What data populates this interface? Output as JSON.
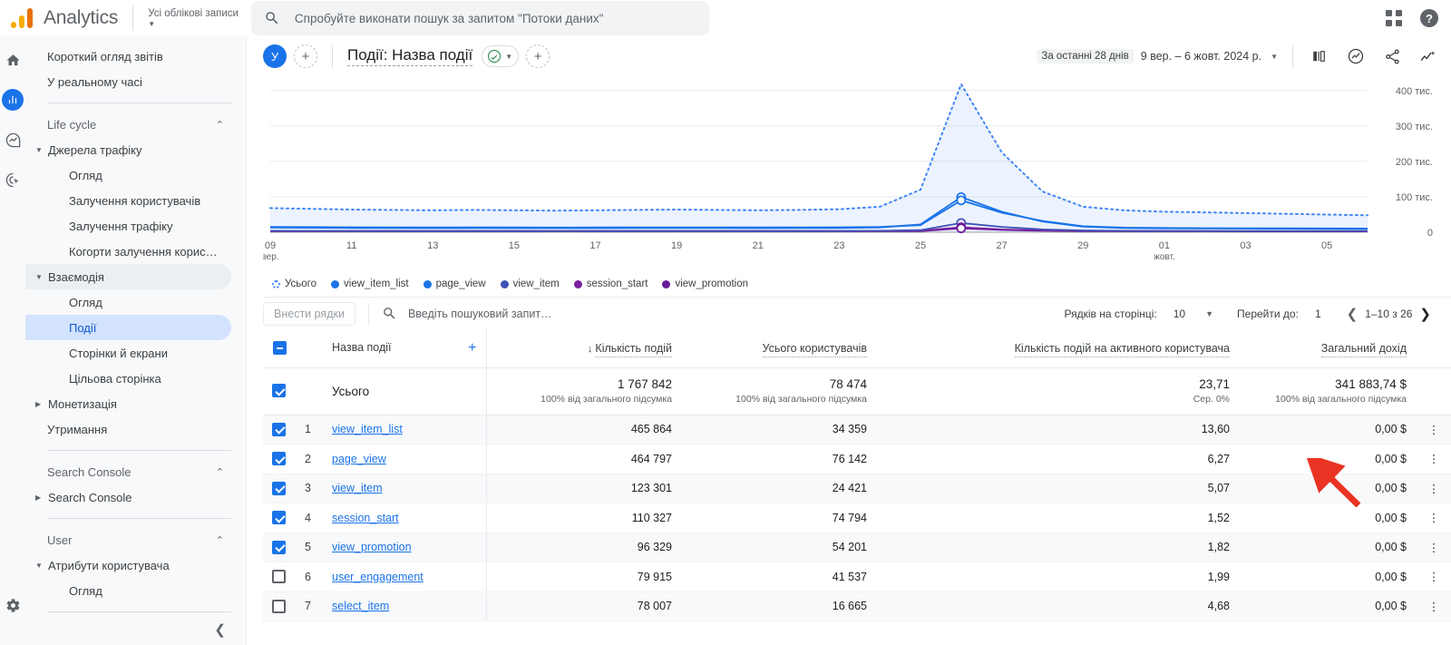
{
  "topbar": {
    "brand": "Analytics",
    "account_selector": "Усі облікові записи",
    "search_placeholder": "Спробуйте виконати пошук за запитом \"Потоки даних\"",
    "search_value": "",
    "apps_icon": "grid-apps-icon",
    "help_icon": "help-icon"
  },
  "rail": {
    "items": [
      {
        "name": "home-icon",
        "label": "Home"
      },
      {
        "name": "reports-icon",
        "label": "Reports"
      },
      {
        "name": "explore-icon",
        "label": "Explore"
      },
      {
        "name": "advertising-icon",
        "label": "Advertising"
      }
    ],
    "settings_icon": "gear-icon"
  },
  "sidebar": {
    "items": [
      {
        "label": "Короткий огляд звітів",
        "level": 1,
        "type": "link"
      },
      {
        "label": "У реальному часі",
        "level": 1,
        "type": "link"
      },
      {
        "type": "separator"
      },
      {
        "label": "Life cycle",
        "level": 1,
        "type": "section",
        "state": "expanded"
      },
      {
        "label": "Джерела трафіку",
        "level": 1,
        "type": "group",
        "state": "expanded"
      },
      {
        "label": "Огляд",
        "level": 2,
        "type": "link"
      },
      {
        "label": "Залучення користувачів",
        "level": 2,
        "type": "link"
      },
      {
        "label": "Залучення трафіку",
        "level": 2,
        "type": "link"
      },
      {
        "label": "Когорти залучення корис…",
        "level": 2,
        "type": "link"
      },
      {
        "label": "Взаємодія",
        "level": 1,
        "type": "group",
        "state": "expanded",
        "highlight": true
      },
      {
        "label": "Огляд",
        "level": 2,
        "type": "link"
      },
      {
        "label": "Події",
        "level": 2,
        "type": "link",
        "selected": true
      },
      {
        "label": "Сторінки й екрани",
        "level": 2,
        "type": "link"
      },
      {
        "label": "Цільова сторінка",
        "level": 2,
        "type": "link"
      },
      {
        "label": "Монетизація",
        "level": 1,
        "type": "group",
        "state": "collapsed"
      },
      {
        "label": "Утримання",
        "level": 1,
        "type": "link"
      },
      {
        "type": "separator"
      },
      {
        "label": "Search Console",
        "level": 1,
        "type": "section",
        "state": "expanded"
      },
      {
        "label": "Search Console",
        "level": 1,
        "type": "group",
        "state": "collapsed"
      },
      {
        "type": "separator"
      },
      {
        "label": "User",
        "level": 1,
        "type": "section",
        "state": "expanded"
      },
      {
        "label": "Атрибути користувача",
        "level": 1,
        "type": "group",
        "state": "expanded"
      },
      {
        "label": "Огляд",
        "level": 2,
        "type": "link"
      },
      {
        "type": "separator"
      }
    ],
    "collapse_icon": "chevron-left-icon"
  },
  "report_header": {
    "avatar_initial": "У",
    "add_comparison": "+",
    "title": "Події: Назва події",
    "validation_icon": "check-circle-icon",
    "add_filter": "+",
    "date_badge": "За останні 28 днів",
    "date_range": "9 вер. – 6 жовт. 2024 р.",
    "icons": [
      {
        "name": "compare-icon"
      },
      {
        "name": "insights-icon"
      },
      {
        "name": "share-icon"
      },
      {
        "name": "trend-icon"
      }
    ]
  },
  "chart_data": {
    "type": "line",
    "title": "",
    "xlabel": "",
    "ylabel": "",
    "ylim": [
      0,
      420000
    ],
    "yticks": [
      0,
      100000,
      200000,
      300000,
      400000
    ],
    "ytick_labels": [
      "0",
      "100 тис.",
      "200 тис.",
      "300 тис.",
      "400 тис."
    ],
    "grid": true,
    "legend_position": "bottom",
    "x": [
      "09",
      "10",
      "11",
      "12",
      "13",
      "14",
      "15",
      "16",
      "17",
      "18",
      "19",
      "20",
      "21",
      "22",
      "23",
      "24",
      "25",
      "26",
      "27",
      "28",
      "29",
      "30",
      "01",
      "02",
      "03",
      "04",
      "05",
      "06"
    ],
    "xtick_labels": [
      "09\nвер.",
      "11",
      "13",
      "15",
      "17",
      "19",
      "21",
      "23",
      "25",
      "27",
      "29",
      "01\nжовт.",
      "03",
      "05"
    ],
    "x_axis_month_start": "вер.",
    "x_axis_month_second": "жовт.",
    "series": [
      {
        "name": "Усього",
        "color": "#4285f4",
        "style": "dotted",
        "filled": true,
        "values": [
          68000,
          66000,
          64000,
          63000,
          62000,
          63000,
          62000,
          61000,
          62000,
          63000,
          64000,
          63000,
          62000,
          63000,
          65000,
          72000,
          120000,
          418000,
          225000,
          115000,
          72000,
          62000,
          58000,
          56000,
          54000,
          52000,
          50000,
          48000
        ]
      },
      {
        "name": "view_item_list",
        "color": "#1a73e8",
        "style": "solid",
        "values": [
          13000,
          12500,
          12000,
          11800,
          11500,
          11700,
          11600,
          11400,
          11500,
          11700,
          11900,
          11800,
          11600,
          11700,
          12000,
          13500,
          22000,
          99000,
          58000,
          30000,
          16000,
          12000,
          11000,
          10500,
          10200,
          10000,
          9800,
          9600
        ]
      },
      {
        "name": "page_view",
        "color": "#1a73e8",
        "style": "solid",
        "values": [
          15000,
          14500,
          14000,
          13800,
          13500,
          13700,
          13600,
          13400,
          13500,
          13700,
          13900,
          13800,
          13600,
          13700,
          14000,
          15000,
          20000,
          90000,
          55000,
          32000,
          17000,
          13000,
          12000,
          11500,
          11200,
          11000,
          10800,
          10600
        ]
      },
      {
        "name": "view_item",
        "color": "#3f51b5",
        "style": "solid",
        "values": [
          4000,
          3900,
          3800,
          3750,
          3700,
          3750,
          3720,
          3700,
          3720,
          3750,
          3800,
          3780,
          3750,
          3780,
          3850,
          4100,
          6000,
          26000,
          15000,
          8000,
          5000,
          4000,
          3800,
          3700,
          3650,
          3600,
          3550,
          3500
        ]
      },
      {
        "name": "session_start",
        "color": "#7b1fa2",
        "style": "solid",
        "values": [
          3400,
          3350,
          3300,
          3280,
          3250,
          3280,
          3260,
          3240,
          3260,
          3280,
          3300,
          3290,
          3270,
          3290,
          3320,
          3400,
          4000,
          14000,
          8000,
          5000,
          3800,
          3400,
          3300,
          3250,
          3200,
          3180,
          3150,
          3100
        ]
      },
      {
        "name": "view_promotion",
        "color": "#6a1b9a",
        "style": "solid",
        "values": [
          2800,
          2780,
          2750,
          2730,
          2720,
          2730,
          2720,
          2700,
          2720,
          2730,
          2750,
          2740,
          2730,
          2740,
          2760,
          2800,
          3200,
          11000,
          6500,
          4200,
          3100,
          2800,
          2750,
          2700,
          2680,
          2650,
          2620,
          2600
        ]
      }
    ],
    "legend": [
      {
        "label": "Усього",
        "color": "#4285f4",
        "marker": "ring"
      },
      {
        "label": "view_item_list",
        "color": "#1a73e8",
        "marker": "dot"
      },
      {
        "label": "page_view",
        "color": "#1a73e8",
        "marker": "dot"
      },
      {
        "label": "view_item",
        "color": "#3f51b5",
        "marker": "dot"
      },
      {
        "label": "session_start",
        "color": "#7b1fa2",
        "marker": "dot"
      },
      {
        "label": "view_promotion",
        "color": "#6a1b9a",
        "marker": "dot"
      }
    ]
  },
  "table_tools": {
    "add_rows_button": "Внести рядки",
    "search_placeholder": "Введіть пошуковий запит…",
    "search_value": "",
    "rows_per_page_label": "Рядків на сторінці:",
    "rows_per_page_value": "10",
    "goto_label": "Перейти до:",
    "goto_value": "1",
    "range_label": "1–10 з 26"
  },
  "table": {
    "columns": [
      {
        "key": "name",
        "label": "Назва події",
        "align": "left",
        "sorted": false
      },
      {
        "key": "event_count",
        "label": "Кількість подій",
        "align": "right",
        "sorted": true,
        "sort_dir": "desc"
      },
      {
        "key": "total_users",
        "label": "Усього користувачів",
        "align": "right",
        "sorted": false
      },
      {
        "key": "events_per_user",
        "label": "Кількість подій на активного користувача",
        "align": "right",
        "sorted": false
      },
      {
        "key": "total_revenue",
        "label": "Загальний дохід",
        "align": "right",
        "sorted": false
      }
    ],
    "totals": {
      "label": "Усього",
      "checked": true,
      "event_count": "1 767 842",
      "event_count_sub": "100% від загального підсумка",
      "total_users": "78 474",
      "total_users_sub": "100% від загального підсумка",
      "events_per_user": "23,71",
      "events_per_user_sub": "Сер. 0%",
      "total_revenue": "341 883,74 $",
      "total_revenue_sub": "100% від загального підсумка"
    },
    "rows": [
      {
        "index": "1",
        "checked": true,
        "name": "view_item_list",
        "event_count": "465 864",
        "total_users": "34 359",
        "events_per_user": "13,60",
        "total_revenue": "0,00 $"
      },
      {
        "index": "2",
        "checked": true,
        "name": "page_view",
        "event_count": "464 797",
        "total_users": "76 142",
        "events_per_user": "6,27",
        "total_revenue": "0,00 $"
      },
      {
        "index": "3",
        "checked": true,
        "name": "view_item",
        "event_count": "123 301",
        "total_users": "24 421",
        "events_per_user": "5,07",
        "total_revenue": "0,00 $"
      },
      {
        "index": "4",
        "checked": true,
        "name": "session_start",
        "event_count": "110 327",
        "total_users": "74 794",
        "events_per_user": "1,52",
        "total_revenue": "0,00 $"
      },
      {
        "index": "5",
        "checked": true,
        "name": "view_promotion",
        "event_count": "96 329",
        "total_users": "54 201",
        "events_per_user": "1,82",
        "total_revenue": "0,00 $"
      },
      {
        "index": "6",
        "checked": false,
        "name": "user_engagement",
        "event_count": "79 915",
        "total_users": "41 537",
        "events_per_user": "1,99",
        "total_revenue": "0,00 $"
      },
      {
        "index": "7",
        "checked": false,
        "name": "select_item",
        "event_count": "78 007",
        "total_users": "16 665",
        "events_per_user": "4,68",
        "total_revenue": "0,00 $"
      }
    ],
    "row_menu_icon": "kebab-menu-icon"
  },
  "annotation": {
    "arrow_color": "#ea3323",
    "arrow_target": "row-menu-page_view"
  }
}
